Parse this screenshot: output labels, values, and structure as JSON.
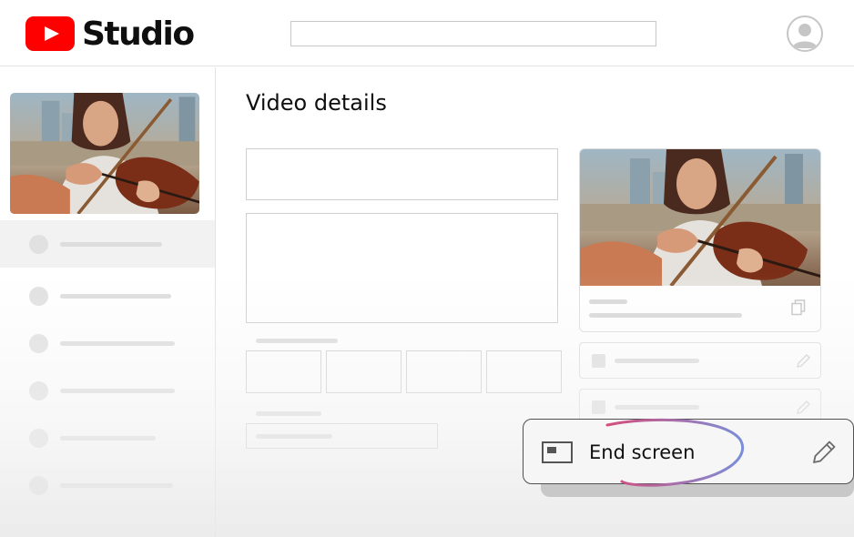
{
  "header": {
    "logo_icon": "youtube-play-icon",
    "brand": "Studio",
    "search_value": "",
    "avatar_icon": "account-icon"
  },
  "sidebar": {
    "video_thumbnail": "video-thumbnail-violinist",
    "items": [
      {
        "active": true
      },
      {
        "active": false
      },
      {
        "active": false
      },
      {
        "active": false
      },
      {
        "active": false
      },
      {
        "active": false
      }
    ]
  },
  "main": {
    "title": "Video details"
  },
  "right_panel": {
    "preview_thumbnail": "video-preview-violinist",
    "copy_icon": "copy-icon",
    "edit_icon": "pencil-icon"
  },
  "popup": {
    "icon": "end-screen-icon",
    "label": "End screen",
    "edit_icon": "pencil-icon"
  },
  "colors": {
    "brand_red": "#ff0000",
    "placeholder_gray": "#dcdcdc",
    "highlight_pink": "#d44e7c",
    "highlight_blue": "#7a8ed8"
  }
}
